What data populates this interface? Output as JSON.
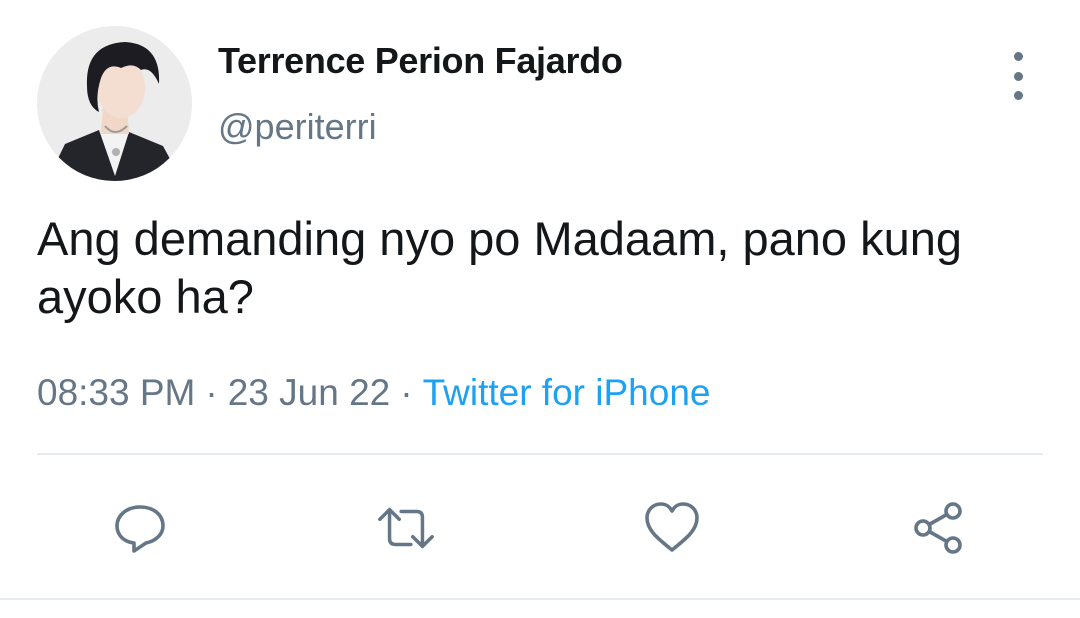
{
  "user": {
    "display_name": "Terrence Perion Fajardo",
    "handle": "@periterri",
    "avatar_icon": "profile-photo"
  },
  "tweet": {
    "text": "Ang demanding nyo po Madaam, pano kung ayoko ha?",
    "time": "08:33 PM",
    "date": "23 Jun 22",
    "separator": "·",
    "source": "Twitter for iPhone"
  },
  "actions": {
    "reply_icon": "reply-icon",
    "retweet_icon": "retweet-icon",
    "like_icon": "like-icon",
    "share_icon": "share-icon"
  },
  "colors": {
    "text": "#14171a",
    "secondary": "#657786",
    "link": "#1da1f2",
    "divider": "#e6ecf0"
  }
}
